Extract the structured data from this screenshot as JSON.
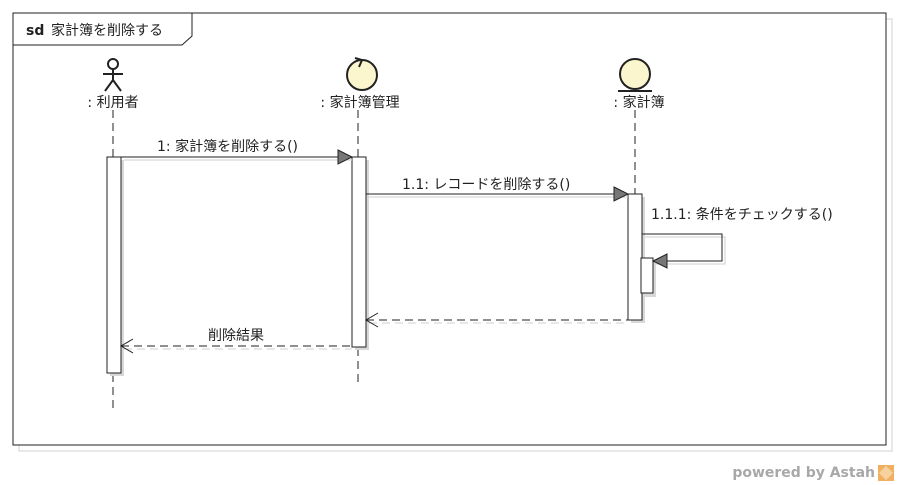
{
  "frame": {
    "keyword": "sd",
    "title": "家計簿を削除する"
  },
  "lifelines": {
    "user": {
      "label": ": 利用者",
      "stereotype": "actor"
    },
    "manager": {
      "label": ": 家計簿管理",
      "stereotype": "control"
    },
    "book": {
      "label": ": 家計簿",
      "stereotype": "entity"
    }
  },
  "messages": {
    "m1": "1: 家計簿を削除する()",
    "m11": "1.1: レコードを削除する()",
    "m111": "1.1.1: 条件をチェックする()",
    "ret": "削除結果"
  },
  "watermark": {
    "text": "powered by Astah"
  },
  "colors": {
    "icon_fill": "#fbf6cd",
    "line": "#222222",
    "arrow_fill": "#777777",
    "watermark": "#a8a8a8"
  }
}
